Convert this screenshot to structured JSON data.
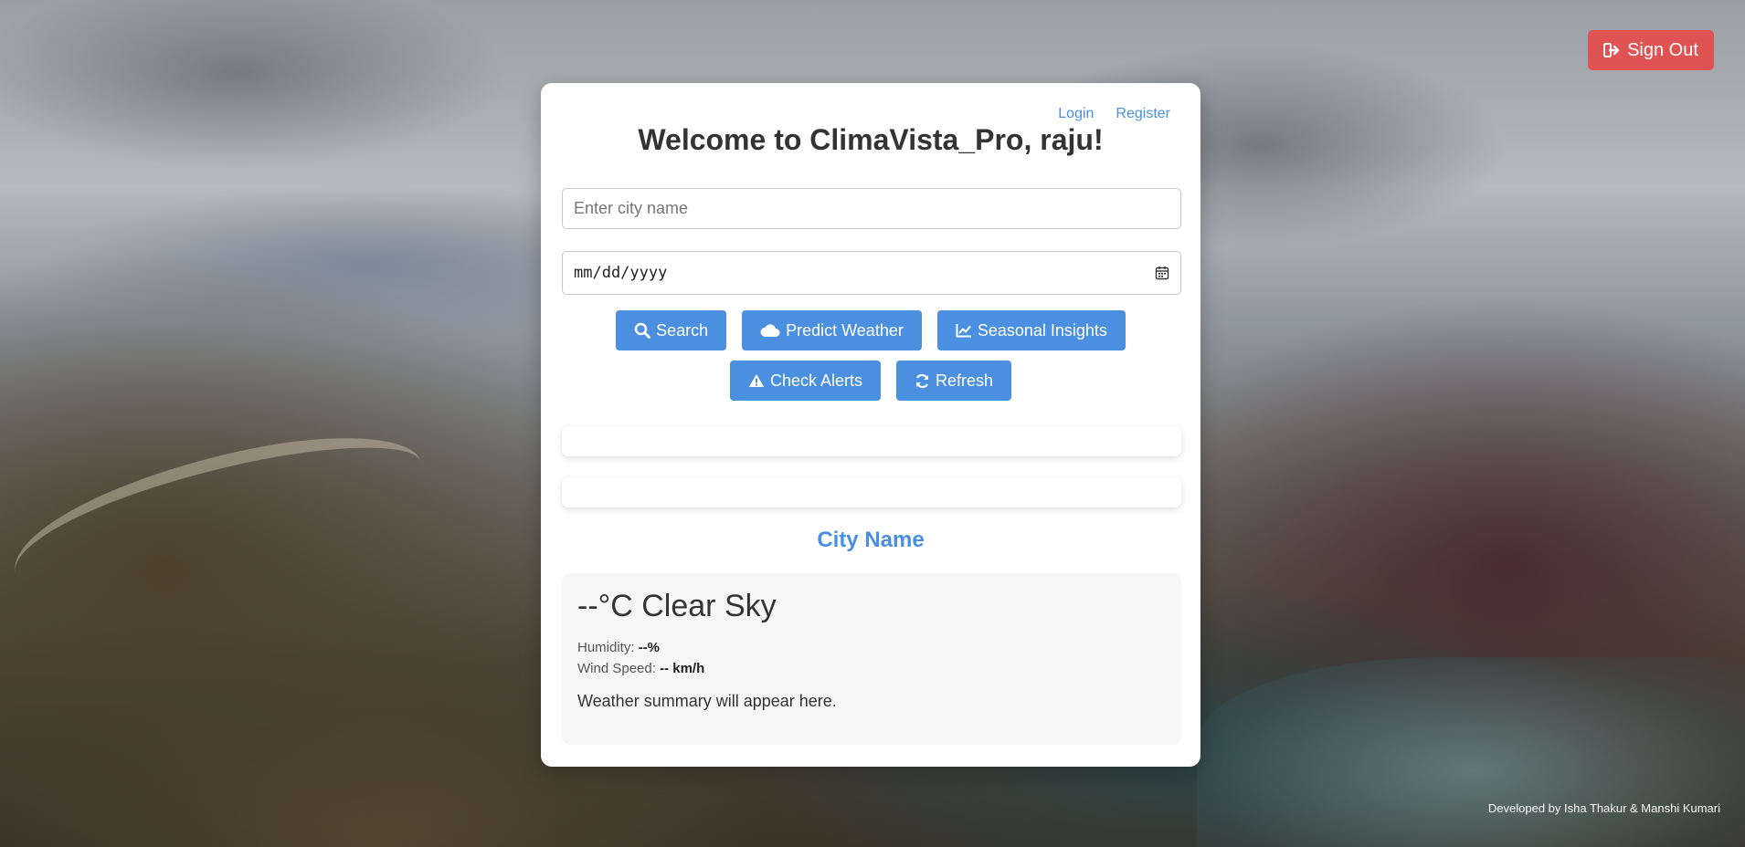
{
  "header": {
    "signout_label": "Sign Out"
  },
  "nav": {
    "login": "Login",
    "register": "Register"
  },
  "card": {
    "title": "Welcome to ClimaVista_Pro, raju!"
  },
  "form": {
    "city_placeholder": "Enter city name",
    "city_value": "",
    "date_placeholder": "mm/dd/yyyy"
  },
  "buttons": {
    "search": "Search",
    "predict": "Predict Weather",
    "seasonal": "Seasonal Insights",
    "alerts": "Check Alerts",
    "refresh": "Refresh"
  },
  "weather": {
    "city_name": "City Name",
    "temperature": "--°C",
    "condition": "Clear Sky",
    "humidity_label": "Humidity:",
    "humidity_value": "--%",
    "wind_label": "Wind Speed:",
    "wind_value": "-- km/h",
    "summary": "Weather summary will appear here."
  },
  "footer": {
    "credits": "Developed by Isha Thakur & Manshi Kumari"
  },
  "colors": {
    "accent": "#4a8fe0",
    "danger": "#e05353",
    "card_bg": "#ffffff",
    "weather_bg": "#f6f6f6"
  },
  "icons": {
    "signout": "sign-out-icon",
    "search": "search-icon",
    "predict": "cloud-icon",
    "seasonal": "line-chart-icon",
    "alerts": "warning-icon",
    "refresh": "refresh-icon",
    "calendar": "calendar-icon"
  }
}
